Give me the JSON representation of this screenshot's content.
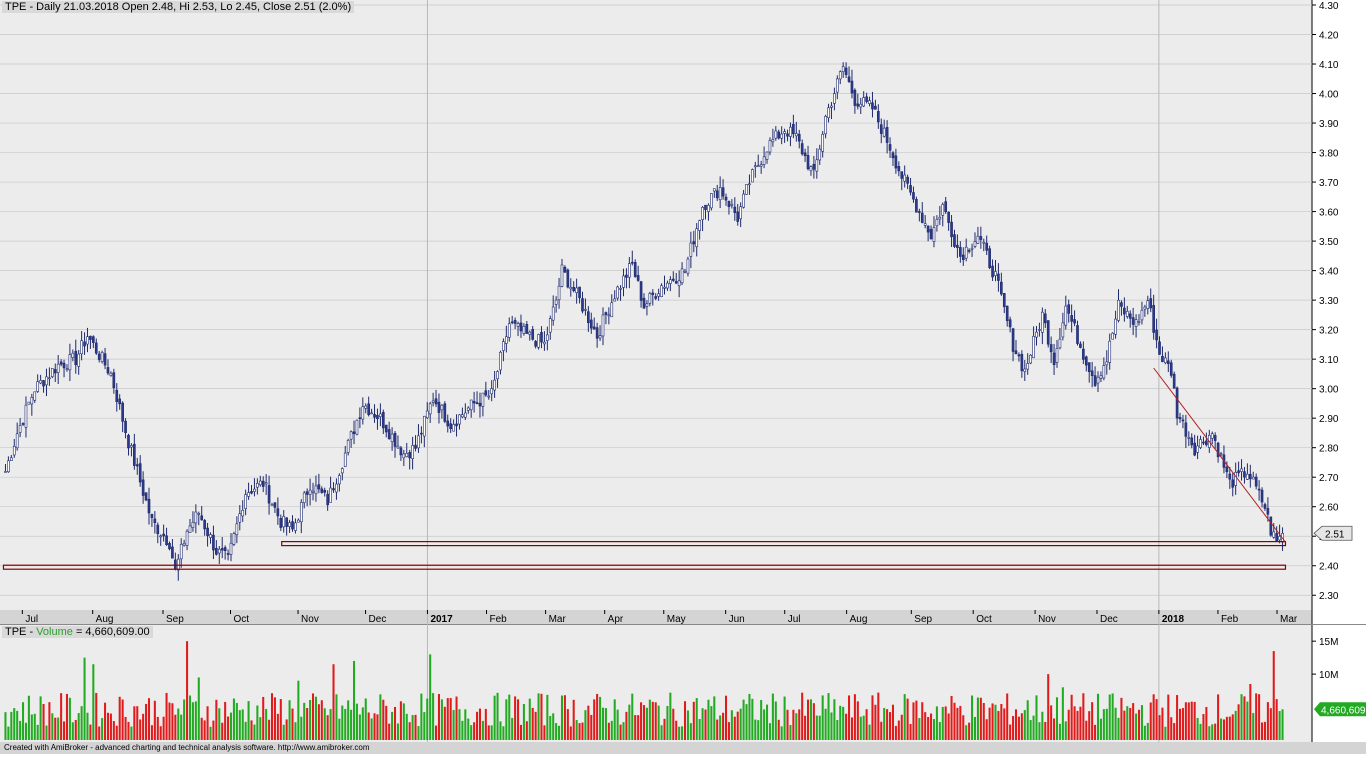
{
  "window": {
    "footer_text": "Created with AmiBroker - advanced charting and technical analysis software. http://www.amibroker.com"
  },
  "price_header": {
    "symbol": "TPE",
    "text": " - Daily 21.03.2018 Open 2.48, Hi 2.53, Lo 2.45, Close 2.51 (2.0%)"
  },
  "volume_header": {
    "symbol": "TPE",
    "dash": " - ",
    "name": "Volume",
    "text": " = 4,660,609.00"
  },
  "colors": {
    "background": "#ececec",
    "candle_stroke": "#1f2a6e",
    "candle_up_fill": "#ffffff",
    "candle_down_fill": "#2b3a8c",
    "volume_up": "#22aa22",
    "volume_down": "#e01b1b",
    "support_line": "#8b0000",
    "trend_line": "#b22222",
    "grid": "#c8c8c8"
  },
  "chart_data": [
    {
      "type": "candlestick",
      "symbol": "TPE",
      "timeframe": "Daily",
      "last_bar": {
        "date": "21.03.2018",
        "open": 2.48,
        "high": 2.53,
        "low": 2.45,
        "close": 2.51,
        "change_pct": "2.0%"
      },
      "price_label": "2.51",
      "ylim": [
        2.25,
        4.3
      ],
      "y_ticks": [
        "4.30",
        "4.20",
        "4.10",
        "4.00",
        "3.90",
        "3.80",
        "3.70",
        "3.60",
        "3.50",
        "3.40",
        "3.30",
        "3.20",
        "3.10",
        "3.00",
        "2.90",
        "2.80",
        "2.70",
        "2.60",
        "2.50",
        "2.40",
        "2.30"
      ],
      "x_ticks": [
        {
          "label": "Jul",
          "bold": false
        },
        {
          "label": "Aug",
          "bold": false
        },
        {
          "label": "Sep",
          "bold": false
        },
        {
          "label": "Oct",
          "bold": false
        },
        {
          "label": "Nov",
          "bold": false
        },
        {
          "label": "Dec",
          "bold": false
        },
        {
          "label": "2017",
          "bold": true
        },
        {
          "label": "Feb",
          "bold": false
        },
        {
          "label": "Mar",
          "bold": false
        },
        {
          "label": "Apr",
          "bold": false
        },
        {
          "label": "May",
          "bold": false
        },
        {
          "label": "Jun",
          "bold": false
        },
        {
          "label": "Jul",
          "bold": false
        },
        {
          "label": "Aug",
          "bold": false
        },
        {
          "label": "Sep",
          "bold": false
        },
        {
          "label": "Oct",
          "bold": false
        },
        {
          "label": "Nov",
          "bold": false
        },
        {
          "label": "Dec",
          "bold": false
        },
        {
          "label": "2018",
          "bold": true
        },
        {
          "label": "Feb",
          "bold": false
        },
        {
          "label": "Mar",
          "bold": false
        }
      ],
      "price_path": [
        [
          0,
          2.72
        ],
        [
          4,
          2.85
        ],
        [
          10,
          3.0
        ],
        [
          18,
          3.08
        ],
        [
          24,
          3.1
        ],
        [
          28,
          3.18
        ],
        [
          36,
          3.05
        ],
        [
          42,
          2.82
        ],
        [
          50,
          2.55
        ],
        [
          56,
          2.48
        ],
        [
          58,
          2.38
        ],
        [
          62,
          2.52
        ],
        [
          66,
          2.58
        ],
        [
          72,
          2.45
        ],
        [
          76,
          2.42
        ],
        [
          82,
          2.65
        ],
        [
          88,
          2.68
        ],
        [
          94,
          2.55
        ],
        [
          98,
          2.52
        ],
        [
          104,
          2.68
        ],
        [
          110,
          2.62
        ],
        [
          116,
          2.78
        ],
        [
          122,
          2.95
        ],
        [
          128,
          2.9
        ],
        [
          136,
          2.78
        ],
        [
          140,
          2.8
        ],
        [
          146,
          2.97
        ],
        [
          152,
          2.88
        ],
        [
          160,
          2.95
        ],
        [
          166,
          2.98
        ],
        [
          172,
          3.22
        ],
        [
          178,
          3.18
        ],
        [
          184,
          3.15
        ],
        [
          188,
          3.3
        ],
        [
          190,
          3.4
        ],
        [
          196,
          3.3
        ],
        [
          202,
          3.18
        ],
        [
          208,
          3.32
        ],
        [
          214,
          3.42
        ],
        [
          218,
          3.28
        ],
        [
          224,
          3.35
        ],
        [
          232,
          3.4
        ],
        [
          238,
          3.62
        ],
        [
          244,
          3.68
        ],
        [
          250,
          3.58
        ],
        [
          254,
          3.7
        ],
        [
          260,
          3.82
        ],
        [
          266,
          3.88
        ],
        [
          270,
          3.85
        ],
        [
          276,
          3.72
        ],
        [
          280,
          3.92
        ],
        [
          286,
          4.09
        ],
        [
          290,
          3.98
        ],
        [
          296,
          3.95
        ],
        [
          302,
          3.82
        ],
        [
          306,
          3.72
        ],
        [
          312,
          3.6
        ],
        [
          316,
          3.52
        ],
        [
          320,
          3.62
        ],
        [
          326,
          3.45
        ],
        [
          332,
          3.52
        ],
        [
          338,
          3.38
        ],
        [
          344,
          3.15
        ],
        [
          348,
          3.06
        ],
        [
          354,
          3.25
        ],
        [
          358,
          3.1
        ],
        [
          362,
          3.28
        ],
        [
          368,
          3.12
        ],
        [
          372,
          3.03
        ],
        [
          376,
          3.1
        ],
        [
          380,
          3.28
        ],
        [
          386,
          3.22
        ],
        [
          390,
          3.3
        ],
        [
          394,
          3.12
        ],
        [
          398,
          3.06
        ],
        [
          400,
          2.92
        ],
        [
          406,
          2.8
        ],
        [
          412,
          2.85
        ],
        [
          418,
          2.68
        ],
        [
          424,
          2.72
        ],
        [
          430,
          2.6
        ],
        [
          432,
          2.52
        ],
        [
          434,
          2.48
        ],
        [
          436,
          2.51
        ]
      ],
      "total_bars": 437,
      "support_lines": [
        {
          "price": 2.475,
          "from_bar": 95,
          "to_bar": 437
        },
        {
          "price": 2.395,
          "from_bar": 0,
          "to_bar": 437
        }
      ],
      "trend_line": {
        "from_bar": 392,
        "from_price": 3.07,
        "to_bar": 437,
        "to_price": 2.48
      },
      "volume": {
        "y_ticks": [
          "15M",
          "10M"
        ],
        "last_value_label": "4,660,609",
        "typical": 4000000,
        "spikes": [
          {
            "bar": 27,
            "value": 12500000,
            "up": true
          },
          {
            "bar": 30,
            "value": 11500000,
            "up": true
          },
          {
            "bar": 62,
            "value": 15000000,
            "up": false
          },
          {
            "bar": 66,
            "value": 9500000,
            "up": true
          },
          {
            "bar": 100,
            "value": 9000000,
            "up": true
          },
          {
            "bar": 112,
            "value": 11500000,
            "up": false
          },
          {
            "bar": 119,
            "value": 12000000,
            "up": true
          },
          {
            "bar": 145,
            "value": 13000000,
            "up": true
          },
          {
            "bar": 356,
            "value": 10000000,
            "up": false
          },
          {
            "bar": 361,
            "value": 8000000,
            "up": true
          },
          {
            "bar": 433,
            "value": 13500000,
            "up": false
          },
          {
            "bar": 425,
            "value": 8500000,
            "up": false
          }
        ]
      }
    }
  ]
}
